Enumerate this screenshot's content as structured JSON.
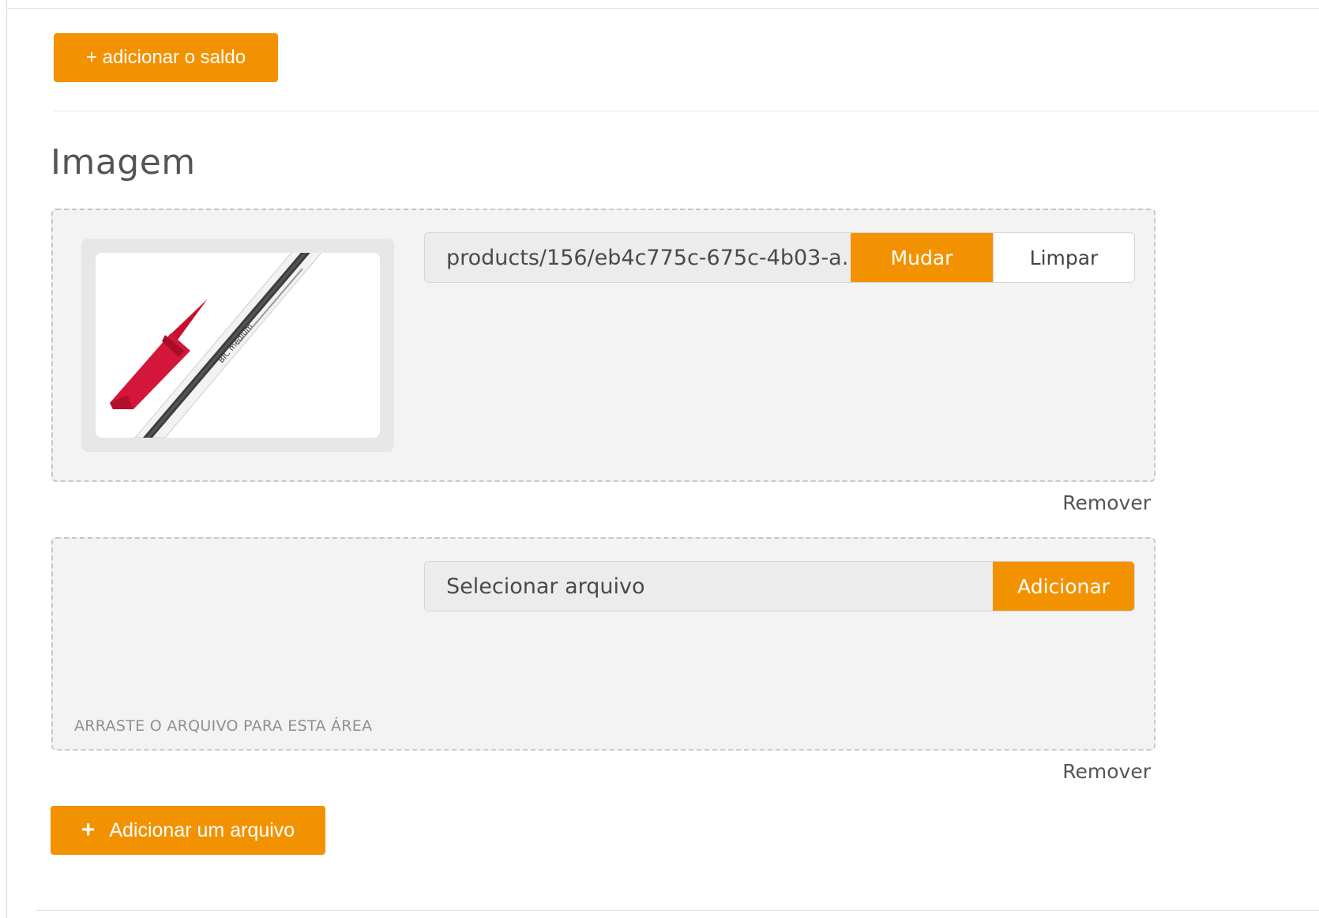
{
  "toolbar": {
    "add_balance_label": "+ adicionar o saldo"
  },
  "image_section": {
    "title": "Imagem",
    "files": [
      {
        "file_name": "products/156/eb4c775c-675c-4b03-a…",
        "change_label": "Mudar",
        "clear_label": "Limpar",
        "remove_label": "Remover",
        "thumbnail": "red-cap-ballpoint-pen"
      },
      {
        "placeholder": "Selecionar arquivo",
        "add_label": "Adicionar",
        "drag_hint": "ARRASTE O ARQUIVO PARA ESTA ÁREA",
        "remove_label": "Remover"
      }
    ],
    "add_file_label": "Adicionar um arquivo"
  },
  "colors": {
    "accent": "#f39200",
    "dropzone_bg": "#f3f3f3",
    "dropzone_border": "#c8c8c8"
  }
}
